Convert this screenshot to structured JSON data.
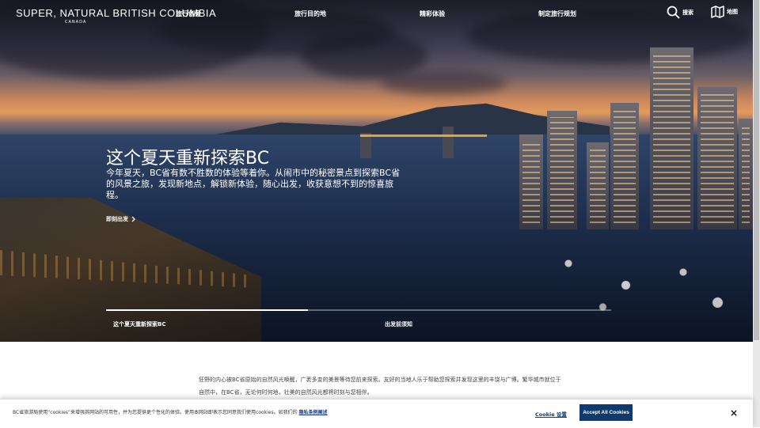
{
  "brand": {
    "logo_text": "SUPER, NATURAL BRITISH COLUMBIA",
    "logo_sub": "CANADA"
  },
  "nav": {
    "items": [
      {
        "label": "旅行创意"
      },
      {
        "label": "旅行目的地"
      },
      {
        "label": "精彩体验"
      },
      {
        "label": "制定旅行规划"
      }
    ],
    "search_label": "搜索",
    "map_label": "地图"
  },
  "hero": {
    "title": "这个夏天重新探索BC",
    "description": "今年夏天，BC省有数不胜数的体验等着你。从闹市中的秘密景点到探索BC省的风景之旅，发现新地点，解锁新体验，随心出发，收获意想不到的惊喜旅程。",
    "cta_label": "即刻出发",
    "slides": [
      {
        "label": "这个夏天重新探索BC"
      },
      {
        "label": "出发前须知"
      }
    ],
    "progress": 0.4
  },
  "intro": {
    "text": "狂野的内心被BC省原始的自然风光唤醒，广袤多变的美景等待您前来探索。友好的当地人乐于帮助您探索并发现这里的丰饶与广博。繁华城市就位于自然中，在BC省，无论何时何地，壮美的自然风光都将时刻与您相伴。"
  },
  "cookie": {
    "text": "BC省旅游局使用“cookies”来增强其网站的可用性，并为您提供更个性化的体验。使用本网站即表示您同意我们使用cookies。如我们的",
    "policy_link": "隐私条例阐述",
    "settings_label": "Cookie 设置",
    "accept_label": "Accept All Cookies",
    "close_label": "×"
  },
  "colors": {
    "accent": "#0e3a6e"
  }
}
